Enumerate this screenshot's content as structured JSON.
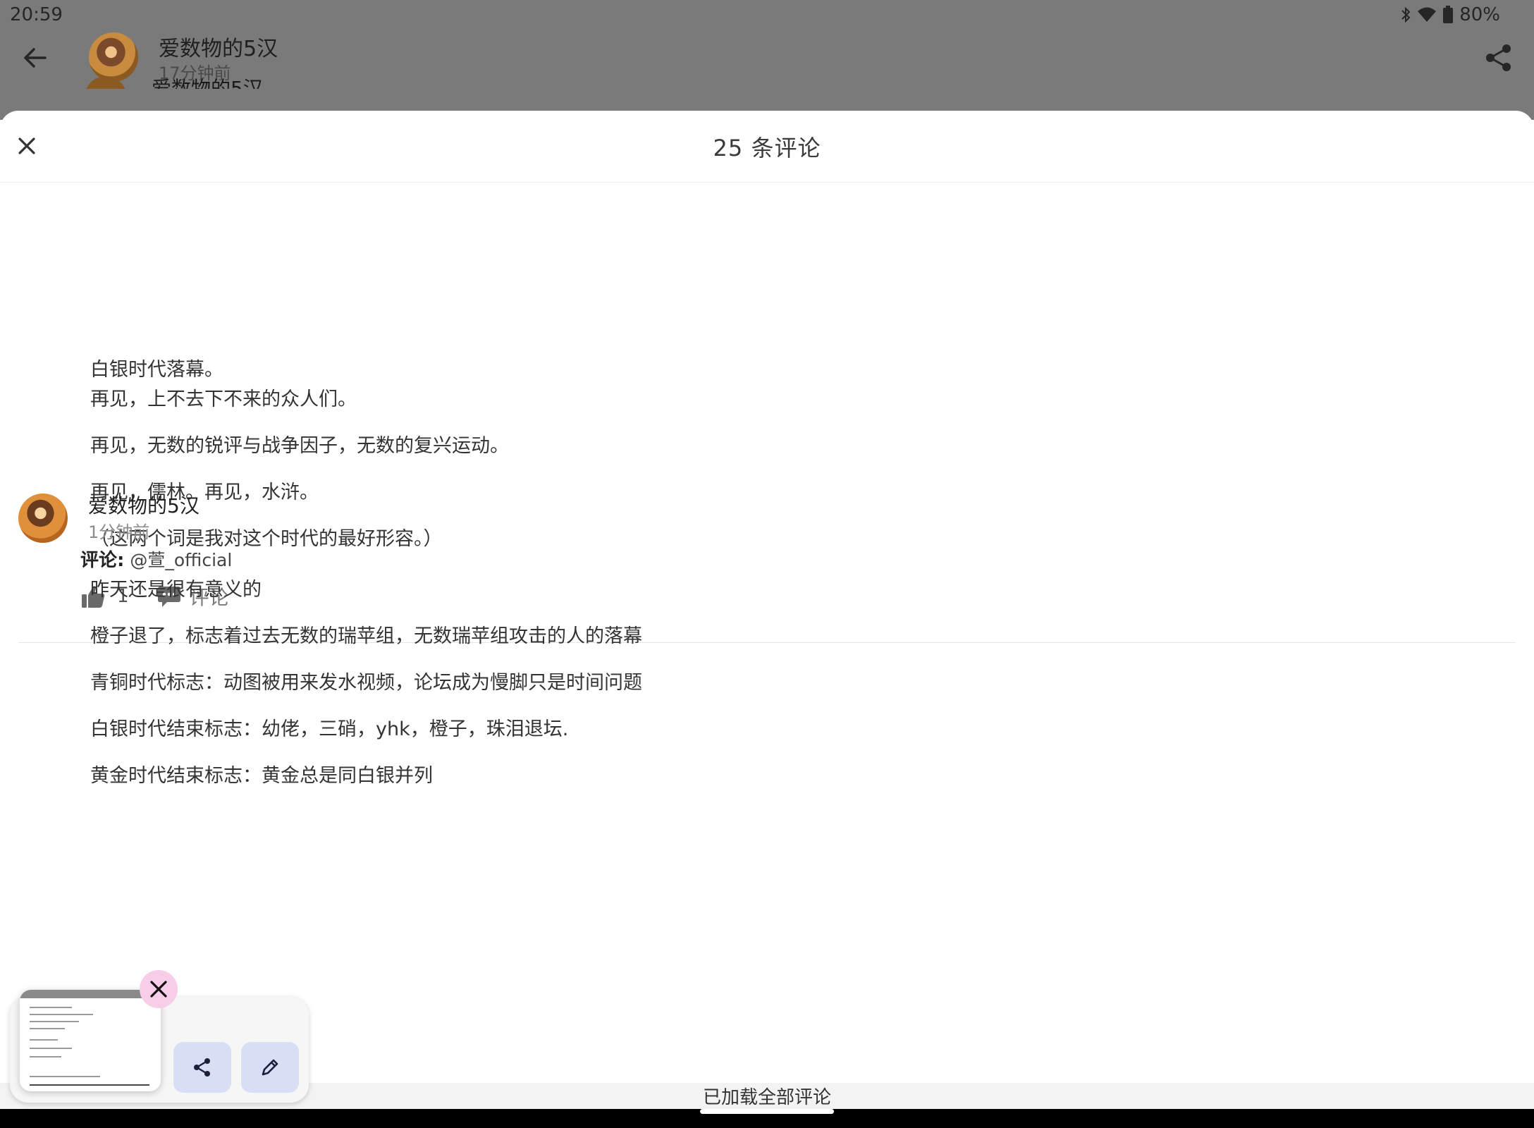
{
  "status_bar": {
    "time": "20:59",
    "battery": "80%",
    "icons": [
      "bluetooth-icon",
      "wifi-icon",
      "battery-icon"
    ]
  },
  "background_page": {
    "author": "爱数物的5汉",
    "time": "17分钟前",
    "peek_text": "爱数物的5汉"
  },
  "sheet": {
    "title": "25 条评论"
  },
  "post": {
    "paragraphs": [
      "白银时代落幕。",
      "再见，上不去下不来的众人们。",
      "再见，无数的锐评与战争因子，无数的复兴运动。",
      "再见，儒林。再见，水浒。",
      "（这两个词是我对这个时代的最好形容。）"
    ],
    "like_count": "1",
    "comment_label": "评论"
  },
  "comment": {
    "author": "爱数物的5汉",
    "time": "1分钟前",
    "reply_label": "评论:",
    "reply_to": "@萱_official",
    "paragraphs": [
      "昨天还是很有意义的",
      "橙子退了，标志着过去无数的瑞苹组，无数瑞苹组攻击的人的落幕",
      "青铜时代标志：动图被用来发水视频，论坛成为慢脚只是时间问题",
      "白银时代结束标志：幼佬，三硝，yhk，橙子，珠泪退坛.",
      "黄金时代结束标志：黄金总是同白银并列"
    ]
  },
  "footer": {
    "loaded_text": "已加载全部评论"
  },
  "floating": {
    "icons": [
      "close-icon",
      "share-icon",
      "edit-icon"
    ]
  }
}
